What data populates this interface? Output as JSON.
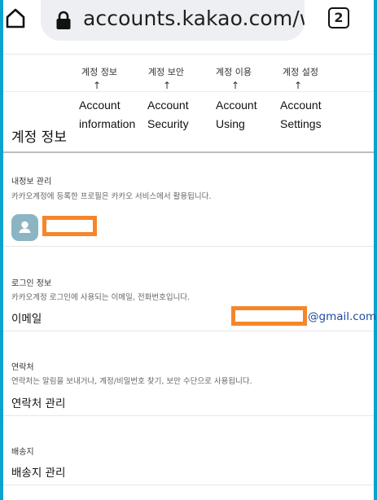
{
  "browser": {
    "url": "accounts.kakao.com/we",
    "tab_count": "2",
    "icons": {
      "home": "home-icon",
      "lock": "lock-icon"
    }
  },
  "nav": {
    "items": [
      {
        "ko": "계정 정보",
        "arrow": "↑",
        "en_line1": "Account",
        "en_line2": "information"
      },
      {
        "ko": "계정 보안",
        "arrow": "↑",
        "en_line1": "Account",
        "en_line2": "Security"
      },
      {
        "ko": "계정 이용",
        "arrow": "↑",
        "en_line1": "Account",
        "en_line2": "Using"
      },
      {
        "ko": "계정 설정",
        "arrow": "↑",
        "en_line1": "Account",
        "en_line2": "Settings"
      }
    ]
  },
  "page": {
    "title": "계정 정보"
  },
  "profile": {
    "label": "내정보 관리",
    "description": "카카오계정에 등록한 프로필은 카카오 서비스에서 활용됩니다.",
    "avatar_icon": "person-icon"
  },
  "login": {
    "label": "로그인 정보",
    "description": "카카오계정 로그인에 사용되는 이메일, 전화번호입니다.",
    "email_label": "이메일",
    "email_domain": "@gmail.com"
  },
  "contact": {
    "label": "연락처",
    "description": "연락처는 알림을 보내거나, 계정/비밀번호 찾기, 보안 수단으로 사용됩니다.",
    "manage_label": "연락처 관리"
  },
  "shipping": {
    "label": "배송지",
    "manage_label": "배송지 관리"
  },
  "colors": {
    "frame": "#0aa3cf",
    "redaction": "#f5862b",
    "avatar": "#8bb5c2",
    "email_domain": "#1e4a9c"
  }
}
